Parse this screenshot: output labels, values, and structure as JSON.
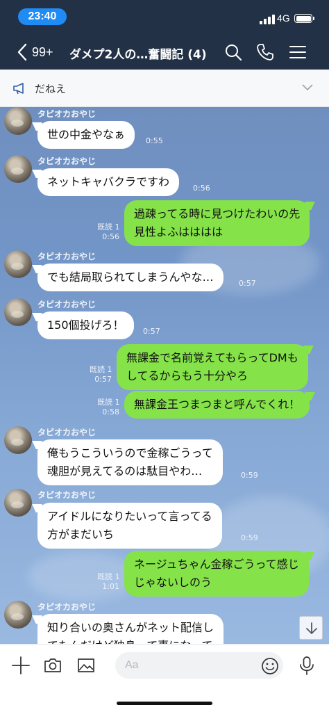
{
  "status_bar": {
    "time": "23:40",
    "network": "4G",
    "battery_level": 1.0
  },
  "nav": {
    "back_count": "99+",
    "title": "ダメプ2人の…奮闘記 (4)",
    "icons": [
      "search-icon",
      "phone-icon",
      "menu-icon"
    ]
  },
  "announcement": {
    "text": "だねえ",
    "icon": "megaphone-icon"
  },
  "messages": {
    "m1": {
      "sender": "タピオカおやじ",
      "text": "世の中金やなぁ",
      "time": "0:55"
    },
    "m2": {
      "sender": "タピオカおやじ",
      "text": "ネットキャバクラですわ",
      "time": "0:56"
    },
    "m3": {
      "line1": "過疎ってる時に見つけたわいの先",
      "line2": "見性よふはははは",
      "read": "既読 1",
      "time": "0:56"
    },
    "m4": {
      "sender": "タピオカおやじ",
      "text": "でも結局取られてしまうんやな…",
      "time": "0:57"
    },
    "m5": {
      "sender": "タピオカおやじ",
      "text": "150個投げろ！",
      "time": "0:57"
    },
    "m6": {
      "line1": "無課金で名前覚えてもらってDMも",
      "line2": "してるからもう十分やろ",
      "read": "既読 1",
      "time": "0:57"
    },
    "m7": {
      "text": "無課金王つまつまと呼んでくれ！",
      "read": "既読 1",
      "time": "0:58"
    },
    "m8": {
      "sender": "タピオカおやじ",
      "line1": "俺もうこういうので金稼ごうって",
      "line2": "魂胆が見えてるのは駄目やわ…",
      "time": "0:59"
    },
    "m9": {
      "sender": "タピオカおやじ",
      "line1": "アイドルになりたいって言ってる",
      "line2": "方がまだいち",
      "time": "0:59"
    },
    "m10": {
      "line1": "ネージュちゃん金稼ごうって感じ",
      "line2": "じゃないしのう",
      "read": "既読 1",
      "time": "1:01"
    },
    "m11": {
      "sender": "タピオカおやじ",
      "line1": "知り合いの奥さんがネット配信し",
      "line2": "てたんだけど独身って事になって"
    }
  },
  "input_bar": {
    "placeholder": "Aa",
    "icons": [
      "plus-icon",
      "camera-icon",
      "image-icon",
      "emoji-icon",
      "mic-icon"
    ]
  },
  "colors": {
    "header": "#223146",
    "outgoing_bubble": "#85e249",
    "incoming_bubble": "#ffffff",
    "time_pill": "#1f8bf5"
  }
}
